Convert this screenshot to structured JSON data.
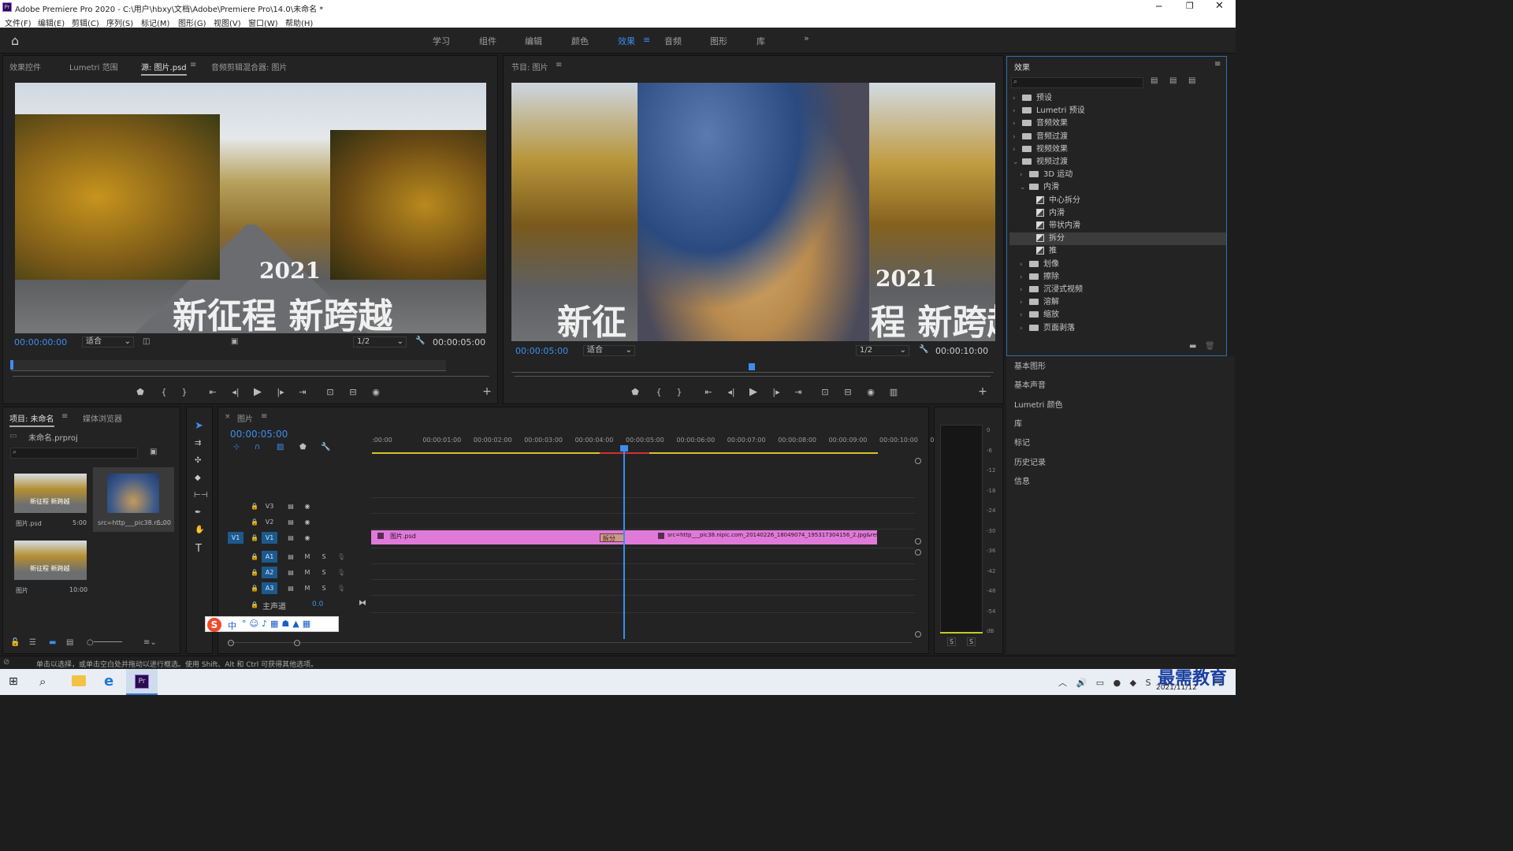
{
  "app": {
    "title": "Adobe Premiere Pro 2020 - C:\\用户\\hbxy\\文档\\Adobe\\Premiere Pro\\14.0\\未命名 *"
  },
  "menu": [
    "文件(F)",
    "编辑(E)",
    "剪辑(C)",
    "序列(S)",
    "标记(M)",
    "图形(G)",
    "视图(V)",
    "窗口(W)",
    "帮助(H)"
  ],
  "workspaces": {
    "items": [
      "学习",
      "组件",
      "编辑",
      "颜色",
      "效果",
      "音频",
      "图形",
      "库"
    ],
    "active": "效果",
    "more": "»"
  },
  "source_panel": {
    "tabs": [
      "效果控件",
      "Lumetri 范围",
      "源: 图片.psd",
      "音频剪辑混合器: 图片"
    ],
    "active_tab": "源: 图片.psd",
    "image_text_year": "2021",
    "image_text_slogan": "新征程 新跨越",
    "timecode": "00:00:00:00",
    "fit": "适合",
    "resolution": "1/2",
    "duration": "00:00:05:00"
  },
  "program_panel": {
    "tab": "节目: 图片",
    "image_text_left": "新征",
    "image_text_year": "2021",
    "image_text_right": "程 新跨越",
    "timecode": "00:00:05:00",
    "fit": "适合",
    "resolution": "1/2",
    "duration": "00:00:10:00"
  },
  "effects_panel": {
    "title": "效果",
    "tree": [
      {
        "label": "预设",
        "level": 0,
        "kind": "folder",
        "open": false
      },
      {
        "label": "Lumetri 预设",
        "level": 0,
        "kind": "folder",
        "open": false
      },
      {
        "label": "音频效果",
        "level": 0,
        "kind": "folder",
        "open": false
      },
      {
        "label": "音频过渡",
        "level": 0,
        "kind": "folder",
        "open": false
      },
      {
        "label": "视频效果",
        "level": 0,
        "kind": "folder",
        "open": false
      },
      {
        "label": "视频过渡",
        "level": 0,
        "kind": "folder",
        "open": true
      },
      {
        "label": "3D 运动",
        "level": 1,
        "kind": "folder",
        "open": false
      },
      {
        "label": "内滑",
        "level": 1,
        "kind": "folder",
        "open": true
      },
      {
        "label": "中心拆分",
        "level": 2,
        "kind": "effect"
      },
      {
        "label": "内滑",
        "level": 2,
        "kind": "effect"
      },
      {
        "label": "带状内滑",
        "level": 2,
        "kind": "effect"
      },
      {
        "label": "拆分",
        "level": 2,
        "kind": "effect",
        "selected": true
      },
      {
        "label": "推",
        "level": 2,
        "kind": "effect"
      },
      {
        "label": "划像",
        "level": 1,
        "kind": "folder",
        "open": false
      },
      {
        "label": "擦除",
        "level": 1,
        "kind": "folder",
        "open": false
      },
      {
        "label": "沉浸式视频",
        "level": 1,
        "kind": "folder",
        "open": false
      },
      {
        "label": "溶解",
        "level": 1,
        "kind": "folder",
        "open": false
      },
      {
        "label": "缩放",
        "level": 1,
        "kind": "folder",
        "open": false
      },
      {
        "label": "页面剥落",
        "level": 1,
        "kind": "folder",
        "open": false
      }
    ]
  },
  "side_panels": [
    "基本图形",
    "基本声音",
    "Lumetri 颜色",
    "库",
    "标记",
    "历史记录",
    "信息"
  ],
  "project_panel": {
    "tabs": [
      "项目: 未命名",
      "媒体浏览器"
    ],
    "file": "未命名.prproj",
    "items": [
      {
        "name": "图片.psd",
        "duration": "5:00"
      },
      {
        "name": "src=http___pic38.n...",
        "duration": "5:00"
      },
      {
        "name": "图片",
        "duration": "10:00"
      }
    ],
    "thumb_text": "新征程 新跨越"
  },
  "timeline": {
    "tab": "图片",
    "timecode": "00:00:05:00",
    "ruler": [
      ":00:00",
      "00:00:01:00",
      "00:00:02:00",
      "00:00:03:00",
      "00:00:04:00",
      "00:00:05:00",
      "00:00:06:00",
      "00:00:07:00",
      "00:00:08:00",
      "00:00:09:00",
      "00:00:10:00",
      "0"
    ],
    "video_tracks": [
      "V3",
      "V2",
      "V1"
    ],
    "audio_tracks": [
      "A1",
      "A2",
      "A3"
    ],
    "source_patch": "V1",
    "mute_label": "M",
    "solo_label": "S",
    "master_label": "主声道",
    "master_value": "0.0",
    "clip1": "图片.psd",
    "transition": "拆分",
    "clip2": "src=http___pic38.nipic.com_20140226_18049074_195317304156_2.jpg&refer="
  },
  "audio_meter": {
    "labels": [
      "0",
      "-6",
      "-12",
      "-18",
      "-24",
      "-30",
      "-36",
      "-42",
      "-48",
      "-54",
      "dB"
    ],
    "solo": [
      "S",
      "S"
    ]
  },
  "ime_bar": {
    "label": "中"
  },
  "status_bar": "单击以选择，或单击空白处并拖动以进行框选。使用 Shift、Alt 和 Ctrl 可获得其他选项。",
  "taskbar": {
    "date": "2021/11/12",
    "watermark": "最需教育",
    "app_label": "Pr"
  },
  "colors": {
    "accent": "#3b8ef0",
    "clip": "#e07ad8",
    "transition": "#c89a8a"
  }
}
